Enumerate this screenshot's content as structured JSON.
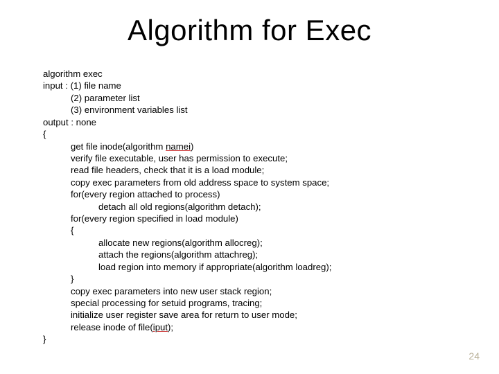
{
  "title": "Algorithm for Exec",
  "lines": {
    "l0": "algorithm exec",
    "l1": "input : (1) file name",
    "l2": "(2) parameter list",
    "l3": "(3) environment variables list",
    "l4": "output : none",
    "l5": "{",
    "l6a": "get file inode(algorithm ",
    "l6b": "namei",
    "l6c": ")",
    "l7": "verify file executable, user has permission to execute;",
    "l8": "read file headers, check that it is a load module;",
    "l9": "copy exec parameters from old address space to system space;",
    "l10": "for(every region attached to process)",
    "l11": "detach all old regions(algorithm detach);",
    "l12": "for(every region specified in load module)",
    "l13": "{",
    "l14": "allocate new regions(algorithm allocreg);",
    "l15": "attach the regions(algorithm attachreg);",
    "l16": "load region into memory if appropriate(algorithm loadreg);",
    "l17": "}",
    "l18": "copy exec parameters into new user stack region;",
    "l19": "special processing for setuid programs, tracing;",
    "l20": "initialize user register save area for return to user mode;",
    "l21a": "release inode of file(",
    "l21b": "iput",
    "l21c": ");",
    "l22": "}"
  },
  "page_number": "24"
}
